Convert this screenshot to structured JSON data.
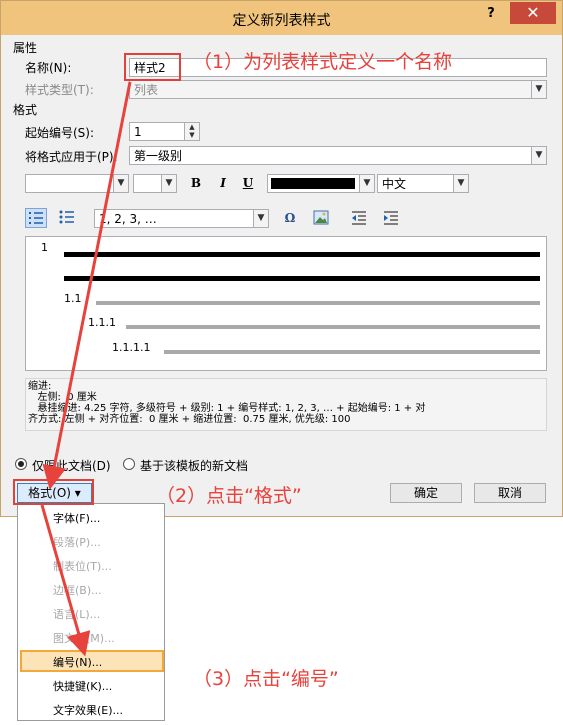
{
  "dialog": {
    "title": "定义新列表样式",
    "help": "?",
    "close": "✕"
  },
  "properties": {
    "section": "属性",
    "name_label": "名称(N):",
    "name_value": "样式2",
    "type_label": "样式类型(T):",
    "type_value": "列表"
  },
  "format": {
    "section": "格式",
    "start_label": "起始编号(S):",
    "start_value": "1",
    "apply_label": "将格式应用于(P):",
    "apply_value": "第一级别",
    "font_value": "",
    "size_value": "",
    "bold": "B",
    "italic": "I",
    "underline": "U",
    "lang_value": "中文",
    "numbering_value": "1, 2, 3, …",
    "omega": "Ω"
  },
  "preview": {
    "level1": "1",
    "level2": "1.1",
    "level3": "1.1.1",
    "level4": "1.1.1.1"
  },
  "description": {
    "line1": "缩进:",
    "line2": "   左侧:  0 厘米",
    "line3": "   悬挂缩进: 4.25 字符, 多级符号 + 级别: 1 + 编号样式: 1, 2, 3, … + 起始编号: 1 + 对",
    "line4": "齐方式: 左侧 + 对齐位置:  0 厘米 + 缩进位置:  0.75 厘米, 优先级: 100"
  },
  "options": {
    "only_doc": "仅限此文档(D)",
    "new_docs": "基于该模板的新文档"
  },
  "buttons": {
    "format": "格式(O) ▾",
    "ok": "确定",
    "cancel": "取消"
  },
  "menu": {
    "items": [
      {
        "label": "字体(F)...",
        "enabled": true
      },
      {
        "label": "段落(P)...",
        "enabled": false
      },
      {
        "label": "制表位(T)...",
        "enabled": false
      },
      {
        "label": "边框(B)...",
        "enabled": false
      },
      {
        "label": "语言(L)...",
        "enabled": false
      },
      {
        "label": "图文框(M)...",
        "enabled": false
      },
      {
        "label": "编号(N)...",
        "enabled": true
      },
      {
        "label": "快捷键(K)...",
        "enabled": true
      },
      {
        "label": "文字效果(E)...",
        "enabled": true
      }
    ]
  },
  "annotations": {
    "step1": "（1）为列表样式定义一个名称",
    "step2": "（2）点击“格式”",
    "step3": "（3）点击“编号”"
  },
  "colors": {
    "titlebar": "#f0c47c",
    "close": "#c7493a",
    "annotation": "#e8423c",
    "highlight_box": "#f2a93a"
  }
}
